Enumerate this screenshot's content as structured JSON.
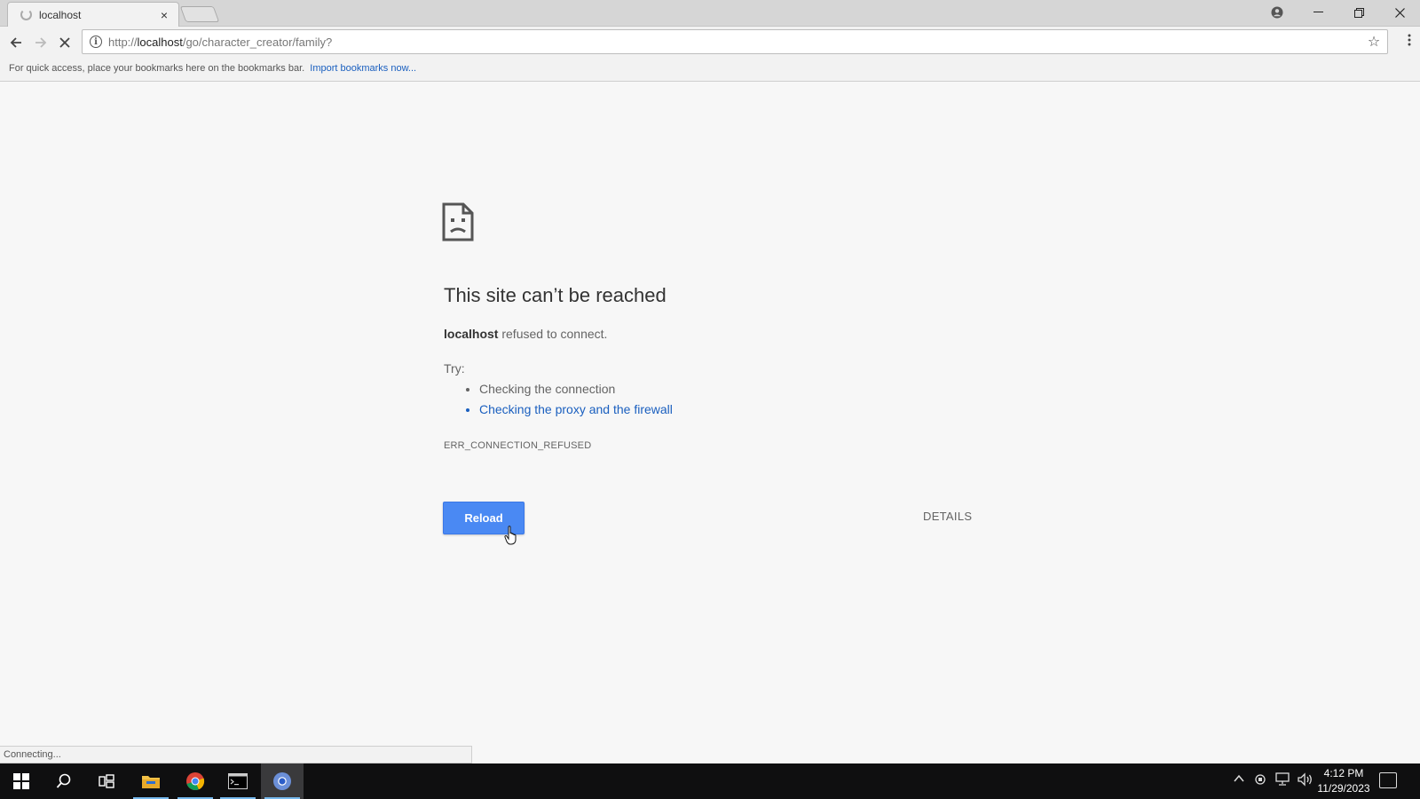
{
  "tab": {
    "title": "localhost",
    "close": "×"
  },
  "omnibox": {
    "url_prefix": "http://",
    "url_host": "localhost",
    "url_path": "/go/character_creator/family?"
  },
  "bookmarks": {
    "text": "For quick access, place your bookmarks here on the bookmarks bar.",
    "import_link": "Import bookmarks now..."
  },
  "error": {
    "title": "This site can’t be reached",
    "host": "localhost",
    "message": "refused to connect.",
    "try_label": "Try:",
    "suggestions": [
      "Checking the connection",
      "Checking the proxy and the firewall"
    ],
    "code": "ERR_CONNECTION_REFUSED",
    "reload_label": "Reload",
    "details_label": "DETAILS"
  },
  "status": {
    "text": "Connecting..."
  },
  "taskbar": {
    "items": [
      "start-icon",
      "search-icon",
      "task-view-icon",
      "file-explorer-icon",
      "chrome-icon",
      "command-prompt-icon",
      "chrome-icon"
    ],
    "clock_time": "4:12 PM",
    "clock_date": "11/29/2023"
  },
  "colors": {
    "accent": "#4a89f3",
    "link": "#1a5fbf",
    "page_bg": "#f7f7f7",
    "taskbar_bg": "#0f0f10"
  }
}
